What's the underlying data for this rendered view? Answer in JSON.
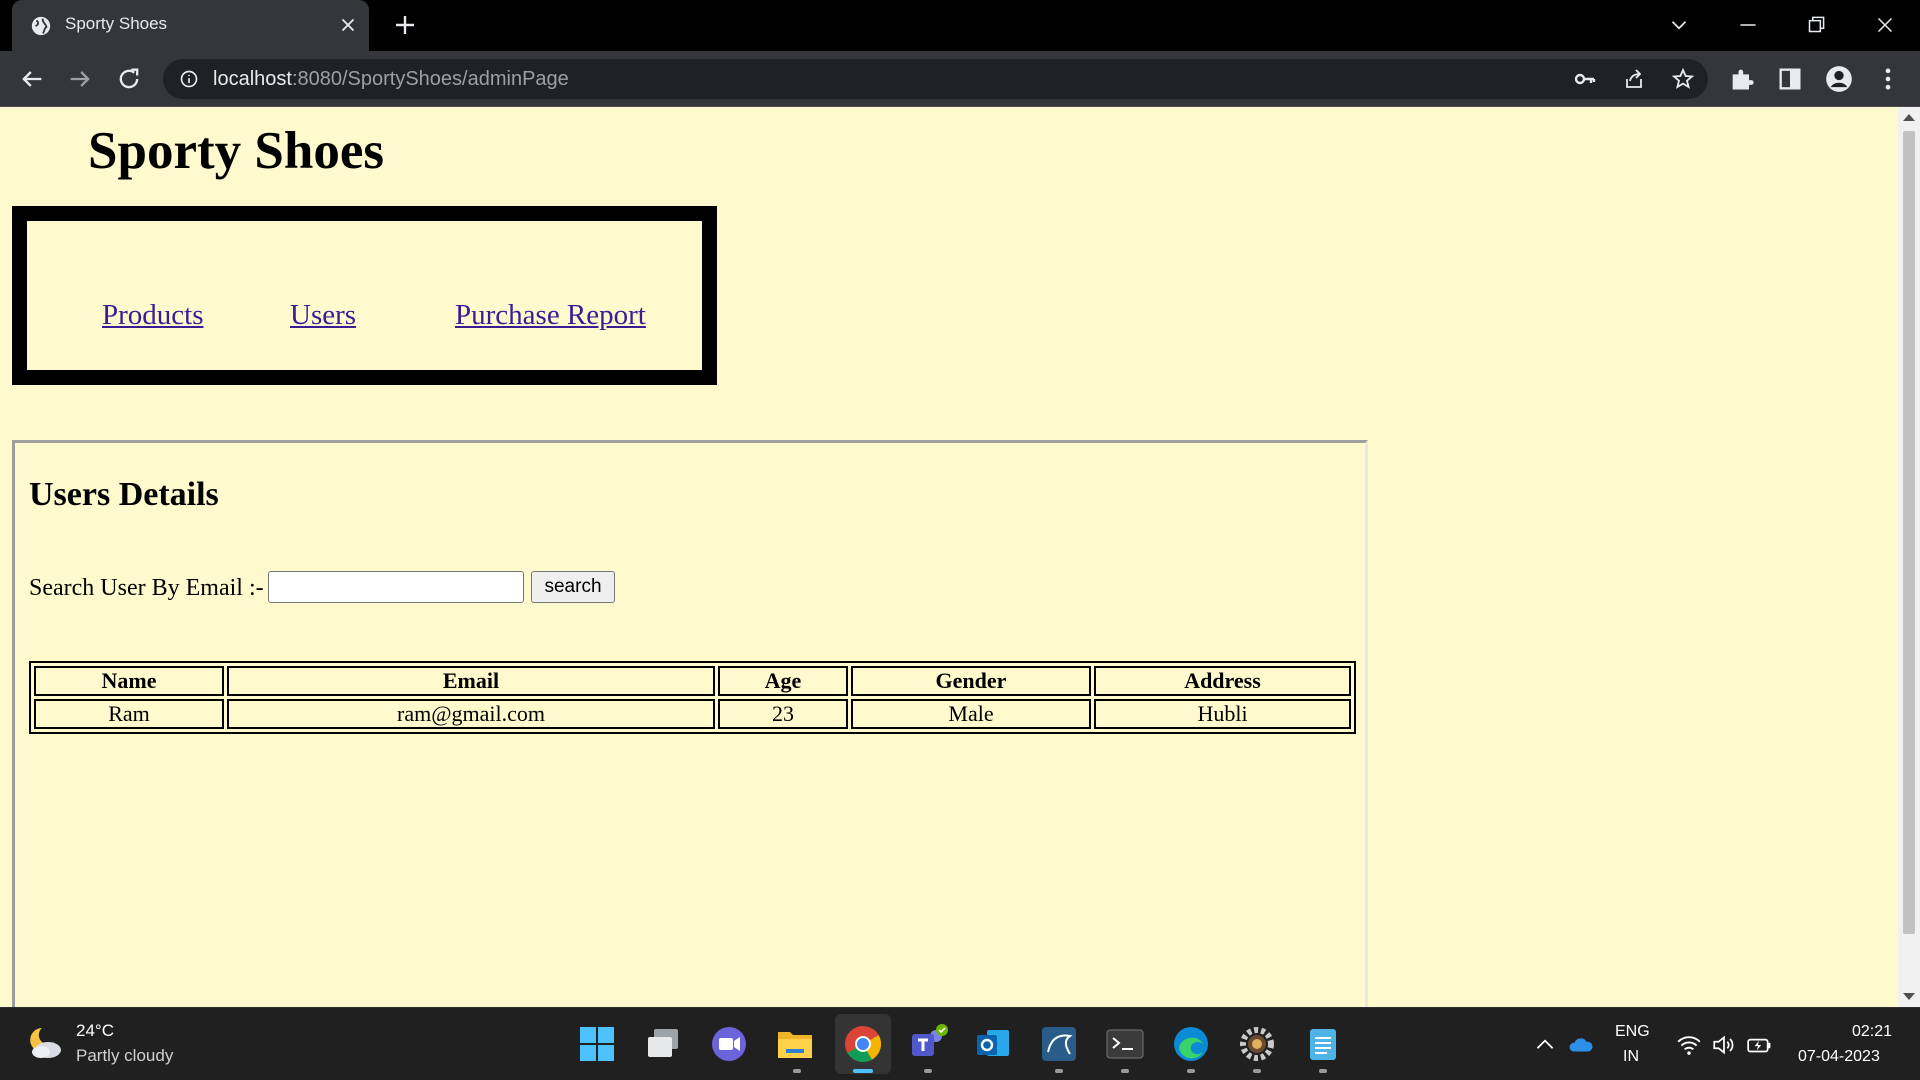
{
  "browser": {
    "tab_title": "Sporty Shoes",
    "url_host": "localhost",
    "url_rest": ":8080/SportyShoes/adminPage"
  },
  "page": {
    "site_title": "Sporty Shoes",
    "nav": [
      {
        "label": "Products"
      },
      {
        "label": "Users"
      },
      {
        "label": "Purchase Report"
      }
    ],
    "users_heading": "Users Details",
    "search_label": "Search User By Email :-",
    "search_value": "",
    "search_button": "search",
    "table": {
      "headers": [
        "Name",
        "Email",
        "Age",
        "Gender",
        "Address"
      ],
      "rows": [
        [
          "Ram",
          "ram@gmail.com",
          "23",
          "Male",
          "Hubli"
        ]
      ]
    }
  },
  "taskbar": {
    "weather_temp": "24°C",
    "weather_desc": "Partly cloudy",
    "lang_line1": "ENG",
    "lang_line2": "IN",
    "time": "02:21",
    "date": "07-04-2023"
  },
  "colors": {
    "page_background": "#fffacd",
    "link": "#3a1d96",
    "chrome_dark": "#35363a"
  }
}
